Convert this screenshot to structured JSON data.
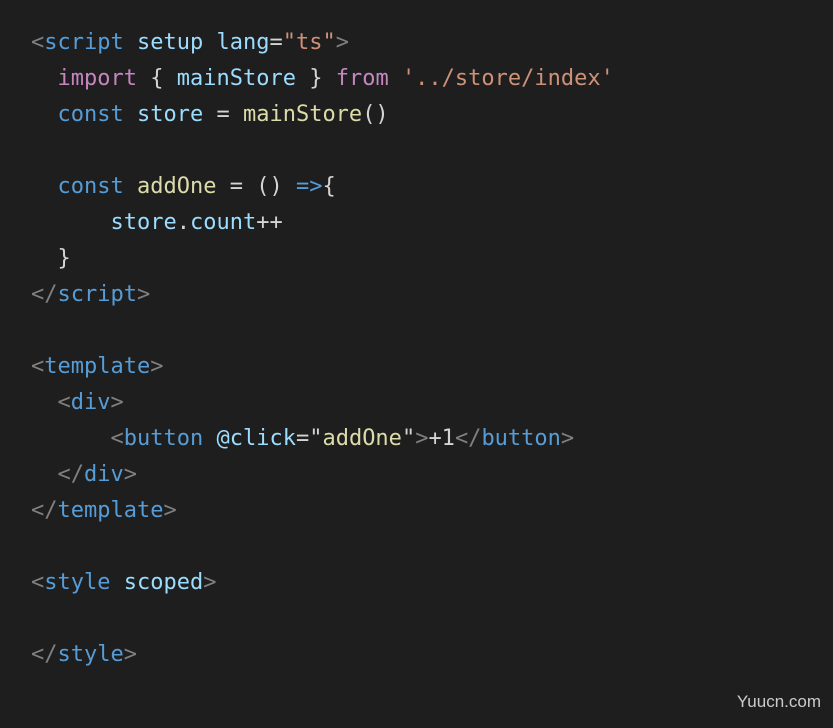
{
  "code": {
    "lines": [
      [
        {
          "t": "<",
          "c": "punct"
        },
        {
          "t": "script",
          "c": "tag"
        },
        {
          "t": " ",
          "c": "op"
        },
        {
          "t": "setup",
          "c": "attr"
        },
        {
          "t": " ",
          "c": "op"
        },
        {
          "t": "lang",
          "c": "attr"
        },
        {
          "t": "=",
          "c": "op"
        },
        {
          "t": "\"ts\"",
          "c": "str"
        },
        {
          "t": ">",
          "c": "punct"
        }
      ],
      [
        {
          "t": "  ",
          "c": "op"
        },
        {
          "t": "import",
          "c": "kw-import"
        },
        {
          "t": " { ",
          "c": "op"
        },
        {
          "t": "mainStore",
          "c": "var"
        },
        {
          "t": " } ",
          "c": "op"
        },
        {
          "t": "from",
          "c": "kw-import"
        },
        {
          "t": " ",
          "c": "op"
        },
        {
          "t": "'../store/index'",
          "c": "str"
        }
      ],
      [
        {
          "t": "  ",
          "c": "op"
        },
        {
          "t": "const",
          "c": "kw-decl"
        },
        {
          "t": " ",
          "c": "op"
        },
        {
          "t": "store",
          "c": "var"
        },
        {
          "t": " = ",
          "c": "op"
        },
        {
          "t": "mainStore",
          "c": "fn"
        },
        {
          "t": "()",
          "c": "op"
        }
      ],
      [],
      [
        {
          "t": "  ",
          "c": "op"
        },
        {
          "t": "const",
          "c": "kw-decl"
        },
        {
          "t": " ",
          "c": "op"
        },
        {
          "t": "addOne",
          "c": "fn"
        },
        {
          "t": " = () ",
          "c": "op"
        },
        {
          "t": "=>",
          "c": "arrow"
        },
        {
          "t": "{",
          "c": "op"
        }
      ],
      [
        {
          "t": "      ",
          "c": "op"
        },
        {
          "t": "store",
          "c": "var"
        },
        {
          "t": ".",
          "c": "op"
        },
        {
          "t": "count",
          "c": "var"
        },
        {
          "t": "++",
          "c": "op"
        }
      ],
      [
        {
          "t": "  }",
          "c": "op"
        }
      ],
      [
        {
          "t": "</",
          "c": "punct"
        },
        {
          "t": "script",
          "c": "tag"
        },
        {
          "t": ">",
          "c": "punct"
        }
      ],
      [],
      [
        {
          "t": "<",
          "c": "punct"
        },
        {
          "t": "template",
          "c": "tag"
        },
        {
          "t": ">",
          "c": "punct"
        }
      ],
      [
        {
          "t": "  ",
          "c": "op"
        },
        {
          "t": "<",
          "c": "punct"
        },
        {
          "t": "div",
          "c": "tag"
        },
        {
          "t": ">",
          "c": "punct"
        }
      ],
      [
        {
          "t": "      ",
          "c": "op"
        },
        {
          "t": "<",
          "c": "punct"
        },
        {
          "t": "button",
          "c": "tag"
        },
        {
          "t": " ",
          "c": "op"
        },
        {
          "t": "@click",
          "c": "attr"
        },
        {
          "t": "=\"",
          "c": "op"
        },
        {
          "t": "addOne",
          "c": "fn"
        },
        {
          "t": "\"",
          "c": "op"
        },
        {
          "t": ">",
          "c": "punct"
        },
        {
          "t": "+1",
          "c": "op"
        },
        {
          "t": "</",
          "c": "punct"
        },
        {
          "t": "button",
          "c": "tag"
        },
        {
          "t": ">",
          "c": "punct"
        }
      ],
      [
        {
          "t": "  ",
          "c": "op"
        },
        {
          "t": "</",
          "c": "punct"
        },
        {
          "t": "div",
          "c": "tag"
        },
        {
          "t": ">",
          "c": "punct"
        }
      ],
      [
        {
          "t": "</",
          "c": "punct"
        },
        {
          "t": "template",
          "c": "tag"
        },
        {
          "t": ">",
          "c": "punct"
        }
      ],
      [],
      [
        {
          "t": "<",
          "c": "punct"
        },
        {
          "t": "style",
          "c": "tag"
        },
        {
          "t": " ",
          "c": "op"
        },
        {
          "t": "scoped",
          "c": "attr"
        },
        {
          "t": ">",
          "c": "punct"
        }
      ],
      [],
      [
        {
          "t": "</",
          "c": "punct"
        },
        {
          "t": "style",
          "c": "tag"
        },
        {
          "t": ">",
          "c": "punct"
        }
      ]
    ]
  },
  "watermark": {
    "text": "Yuucn.com"
  },
  "colors": {
    "background": "#1e1e1e",
    "tag": "#569cd6",
    "attribute": "#9cdcfe",
    "string": "#ce9178",
    "keyword_import": "#c586c0",
    "function": "#dcdcaa",
    "punctuation": "#808080",
    "default_text": "#d4d4d4"
  }
}
